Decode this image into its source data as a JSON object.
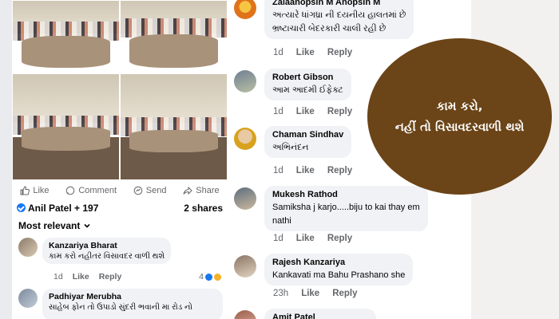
{
  "post": {
    "actions": {
      "like": "Like",
      "comment": "Comment",
      "send": "Send",
      "share": "Share"
    },
    "reactions_summary": "Anil Patel + 197",
    "shares": "2 shares",
    "sort_label": "Most relevant"
  },
  "left_comments": [
    {
      "name": "Kanzariya Bharat",
      "text": "કામ કરો નહીતર વિસાવદર વાળી થશે",
      "time": "1d",
      "like": "Like",
      "reply": "Reply",
      "reaction_count": "4"
    },
    {
      "name": "Padhiyar Merubha",
      "text": "સાહેબ ફોન તો ઉપાડો સુંદરી ભવાની મા રોડ નો",
      "time": "",
      "like": "",
      "reply": ""
    }
  ],
  "right_comments": [
    {
      "name": "Zalaanopsin M Anopsin M",
      "text_lines": [
        "અત્યારે ધાંગધ્રા ની દયનીય હાલતમાં છે",
        "ભ્રષ્ટાચારી બેદરકારી ચાલી રહી છે"
      ],
      "time": "1d",
      "like": "Like",
      "reply": "Reply"
    },
    {
      "name": "Robert Gibson",
      "text_lines": [
        "આમ આદમી ઈફેક્ટ"
      ],
      "time": "1d",
      "like": "Like",
      "reply": "Reply"
    },
    {
      "name": "Chaman Sindhav",
      "text_lines": [
        "અભિનંદન"
      ],
      "time": "1d",
      "like": "Like",
      "reply": "Reply"
    },
    {
      "name": "Mukesh Rathod",
      "text_lines": [
        "Samiksha j karjo.....biju to kai thay em",
        "nathi"
      ],
      "time": "1d",
      "like": "Like",
      "reply": "Reply"
    },
    {
      "name": "Rajesh Kanzariya",
      "text_lines": [
        "Kankavati ma Bahu Prashano she"
      ],
      "time": "23h",
      "like": "Like",
      "reply": "Reply"
    },
    {
      "name": "Amit Patel",
      "text_lines": [],
      "time": "",
      "like": "",
      "reply": ""
    }
  ],
  "overlay": {
    "line1": "કામ કરો,",
    "line2": "નહીં તો વિસાવદરવાળી થશે"
  },
  "colors": {
    "overlay_brown": "#6b4417",
    "accent_blue": "#1877f2"
  }
}
